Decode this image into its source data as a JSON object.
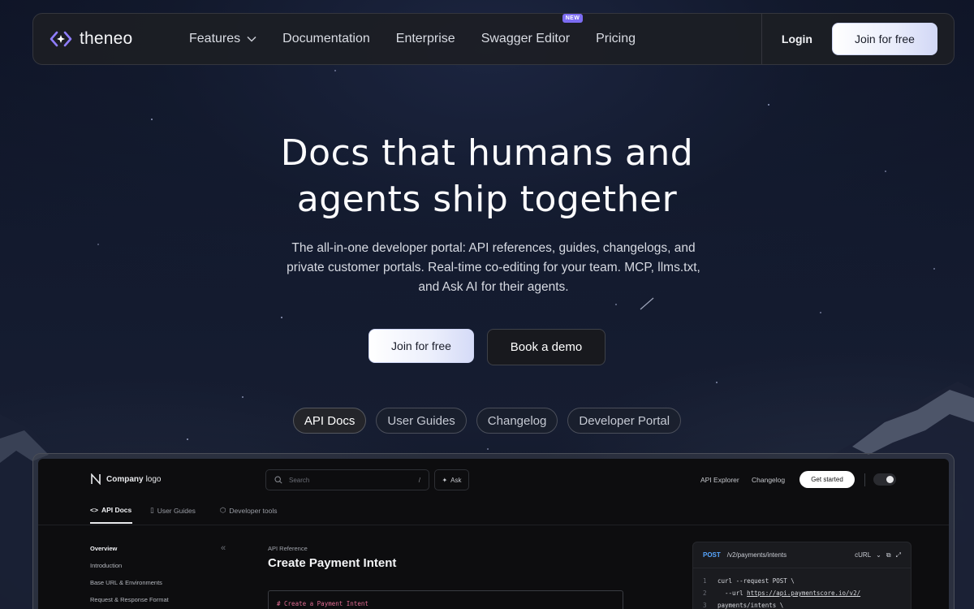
{
  "brand": {
    "name": "theneo"
  },
  "nav": {
    "items": [
      {
        "label": "Features",
        "has_dropdown": true
      },
      {
        "label": "Documentation"
      },
      {
        "label": "Enterprise"
      },
      {
        "label": "Swagger Editor",
        "badge": "NEW"
      },
      {
        "label": "Pricing"
      }
    ],
    "login_label": "Login",
    "join_label": "Join for free"
  },
  "hero": {
    "title_line1": "Docs that humans and",
    "title_line2": "agents ship together",
    "subtitle": "The all-in-one developer portal: API references, guides, changelogs, and private customer portals. Real-time co-editing for your team. MCP, llms.txt, and Ask AI for their agents.",
    "cta_primary": "Join for free",
    "cta_secondary": "Book a demo"
  },
  "tabs": [
    {
      "label": "API Docs",
      "active": true
    },
    {
      "label": "User Guides",
      "active": false
    },
    {
      "label": "Changelog",
      "active": false
    },
    {
      "label": "Developer Portal",
      "active": false
    }
  ],
  "preview": {
    "logo_bold": "Company",
    "logo_rest": "logo",
    "search_placeholder": "Search",
    "search_shortcut": "/",
    "ask_label": "Ask",
    "links": [
      "API Explorer",
      "Changelog"
    ],
    "get_started": "Get started",
    "tabs": [
      "API Docs",
      "User Guides",
      "Developer tools"
    ],
    "sidebar": [
      "Overview",
      "Introduction",
      "Base URL & Environments",
      "Request & Response Format"
    ],
    "breadcrumb": "API Reference",
    "heading": "Create Payment Intent",
    "code_comment": "# Create a Payment Intent",
    "code_panel": {
      "method": "POST",
      "path": "/v2/payments/intents",
      "language": "cURL",
      "lines": [
        {
          "n": "1",
          "text": "curl --request POST \\"
        },
        {
          "n": "2",
          "prefix": "  --url ",
          "url": "https://api.paymentscore.io/v2/"
        },
        {
          "n": "3",
          "text": "payments/intents \\"
        }
      ]
    }
  },
  "colors": {
    "accent_badge": "#7c6cf2",
    "method_post": "#57a6ff",
    "code_comment": "#e06c92"
  }
}
